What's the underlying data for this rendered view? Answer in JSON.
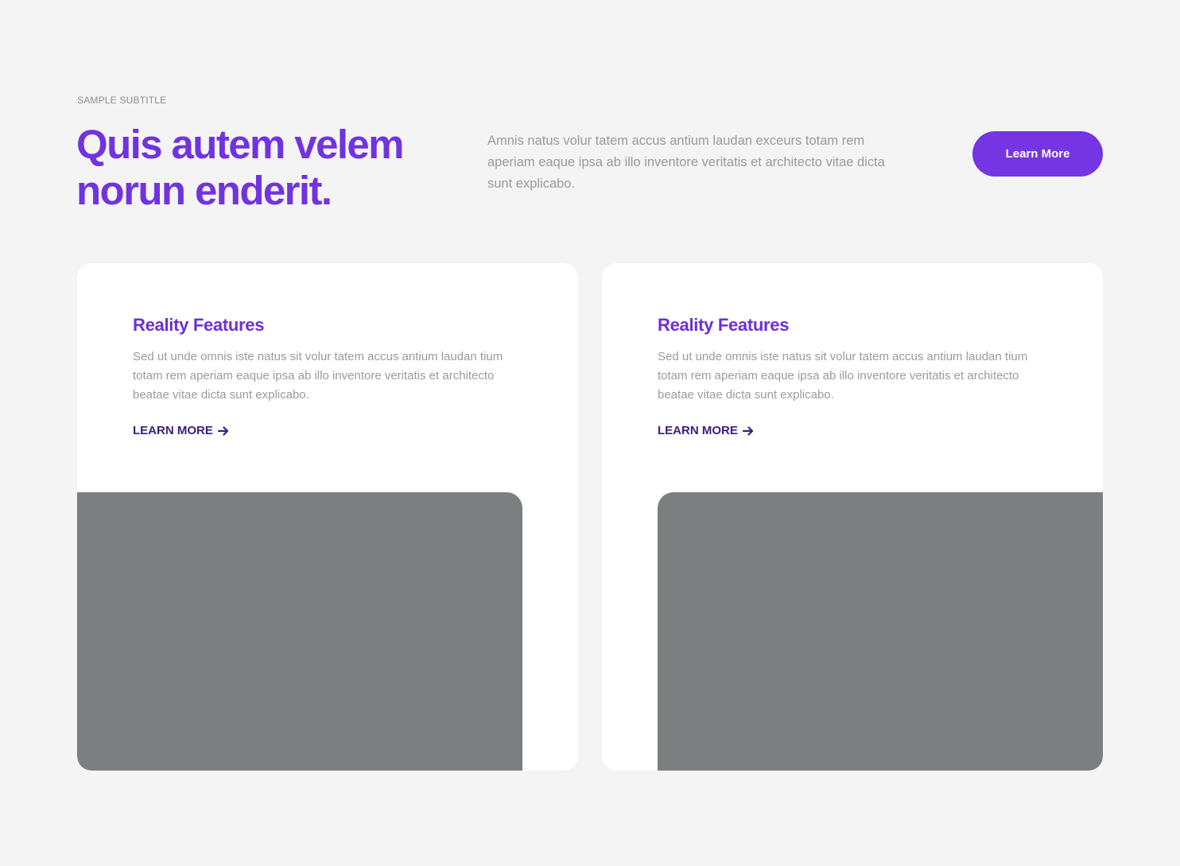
{
  "header": {
    "subtitle": "SAMPLE SUBTITLE",
    "headline": "Quis autem velem norun enderit.",
    "intro": "Amnis natus volur tatem accus antium laudan exceurs totam rem aperiam eaque ipsa ab illo inventore veritatis et architecto vitae dicta sunt explicabo.",
    "cta_label": "Learn More"
  },
  "cards": [
    {
      "title": "Reality Features",
      "text": "Sed ut unde omnis iste natus sit volur tatem accus antium laudan tium totam rem aperiam eaque ipsa ab illo inventore veritatis et architecto beatae vitae dicta sunt explicabo.",
      "link_label": "LEARN MORE",
      "link_icon": "arrow-right-icon"
    },
    {
      "title": "Reality Features",
      "text": "Sed ut unde omnis iste natus sit volur tatem accus antium laudan tium totam rem aperiam eaque ipsa ab illo inventore veritatis et architecto beatae vitae dicta sunt explicabo.",
      "link_label": "LEARN MORE",
      "link_icon": "arrow-right-icon"
    }
  ],
  "colors": {
    "accent": "#7535e2",
    "headline": "#7133df",
    "background": "#f4f4f4",
    "card": "#ffffff",
    "image_placeholder": "#7d7e80"
  }
}
